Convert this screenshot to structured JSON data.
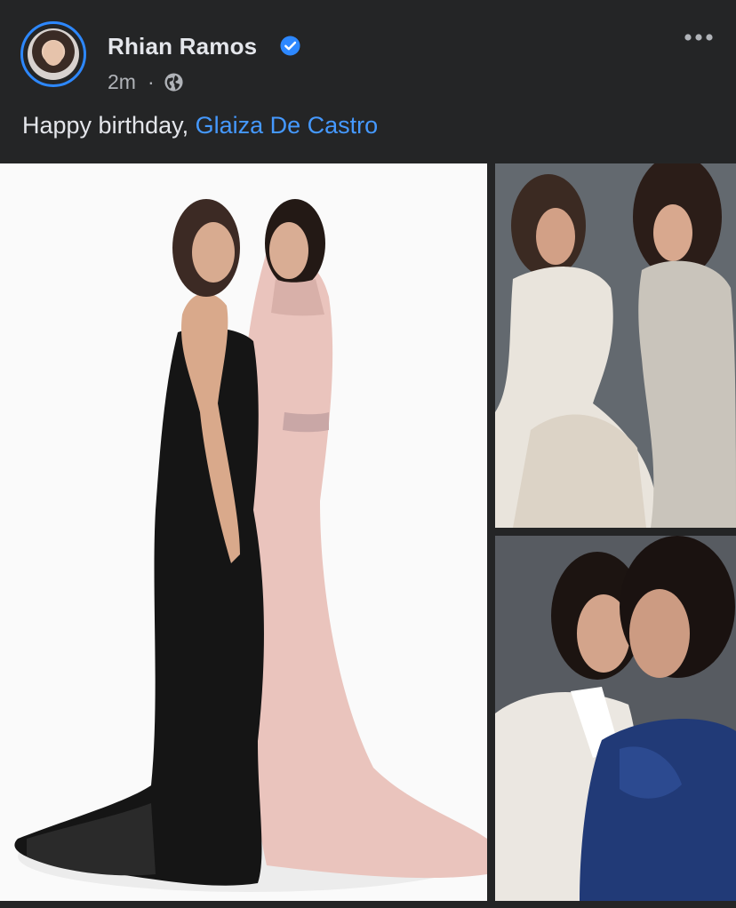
{
  "post": {
    "author": "Rhian Ramos",
    "verified": true,
    "timestamp": "2m",
    "separator": "·",
    "audience_icon": "globe-icon",
    "more_icon": "more-options-icon",
    "caption_text": "Happy birthday, ",
    "caption_mention": "Glaiza De Castro"
  },
  "colors": {
    "background": "#242526",
    "text_primary": "#e4e6eb",
    "text_secondary": "#b0b3b8",
    "link": "#4599ff",
    "verified": "#2d88ff"
  },
  "photos": [
    {
      "name": "photo-main",
      "subject": "two women in black and pink gowns"
    },
    {
      "name": "photo-top-right",
      "subject": "two women in white and silver gowns"
    },
    {
      "name": "photo-bottom-right",
      "subject": "two women in white blouse and blue dress"
    }
  ]
}
